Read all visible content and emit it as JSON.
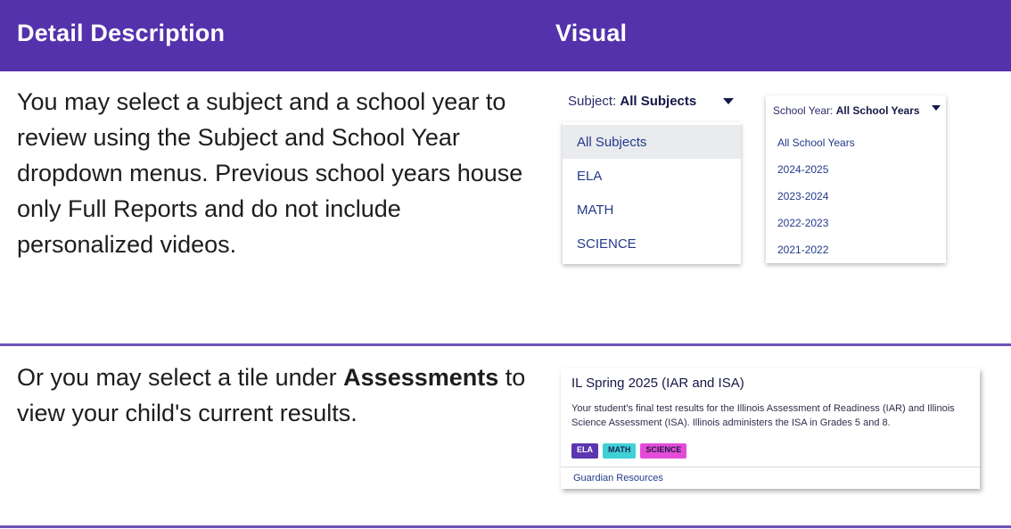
{
  "header": {
    "col_left": "Detail Description",
    "col_right": "Visual"
  },
  "row1": {
    "text": "You may select a subject and a school year to review using the Subject and School Year dropdown menus. Previous school years house only Full Reports and do not include personalized videos."
  },
  "subject_dropdown": {
    "label": "Subject: ",
    "value": "All Subjects",
    "options": [
      "All Subjects",
      "ELA",
      "MATH",
      "SCIENCE"
    ],
    "selected_index": 0
  },
  "year_dropdown": {
    "label": "School Year: ",
    "value": "All School Years",
    "options": [
      "All School Years",
      "2024-2025",
      "2023-2024",
      "2022-2023",
      "2021-2022"
    ]
  },
  "row2": {
    "text_before": "Or you may select a tile under ",
    "text_bold": "Assessments",
    "text_after": " to view your child's current results."
  },
  "assessment_tile": {
    "title": "IL Spring 2025 (IAR and ISA)",
    "body_line1": "Your student's final test results for the Illinois Assessment of Readiness (IAR) and Illinois",
    "body_line2": "Science Assessment (ISA). Illinois administers the ISA in Grades 5 and 8.",
    "tags": [
      "ELA",
      "MATH",
      "SCIENCE"
    ],
    "tag_colors": [
      "#5a36b1",
      "#3fd1d6",
      "#e44bd9"
    ],
    "link": "Guardian Resources"
  },
  "colors": {
    "header_bg": "#5332ac",
    "divider": "#6a55b8"
  }
}
